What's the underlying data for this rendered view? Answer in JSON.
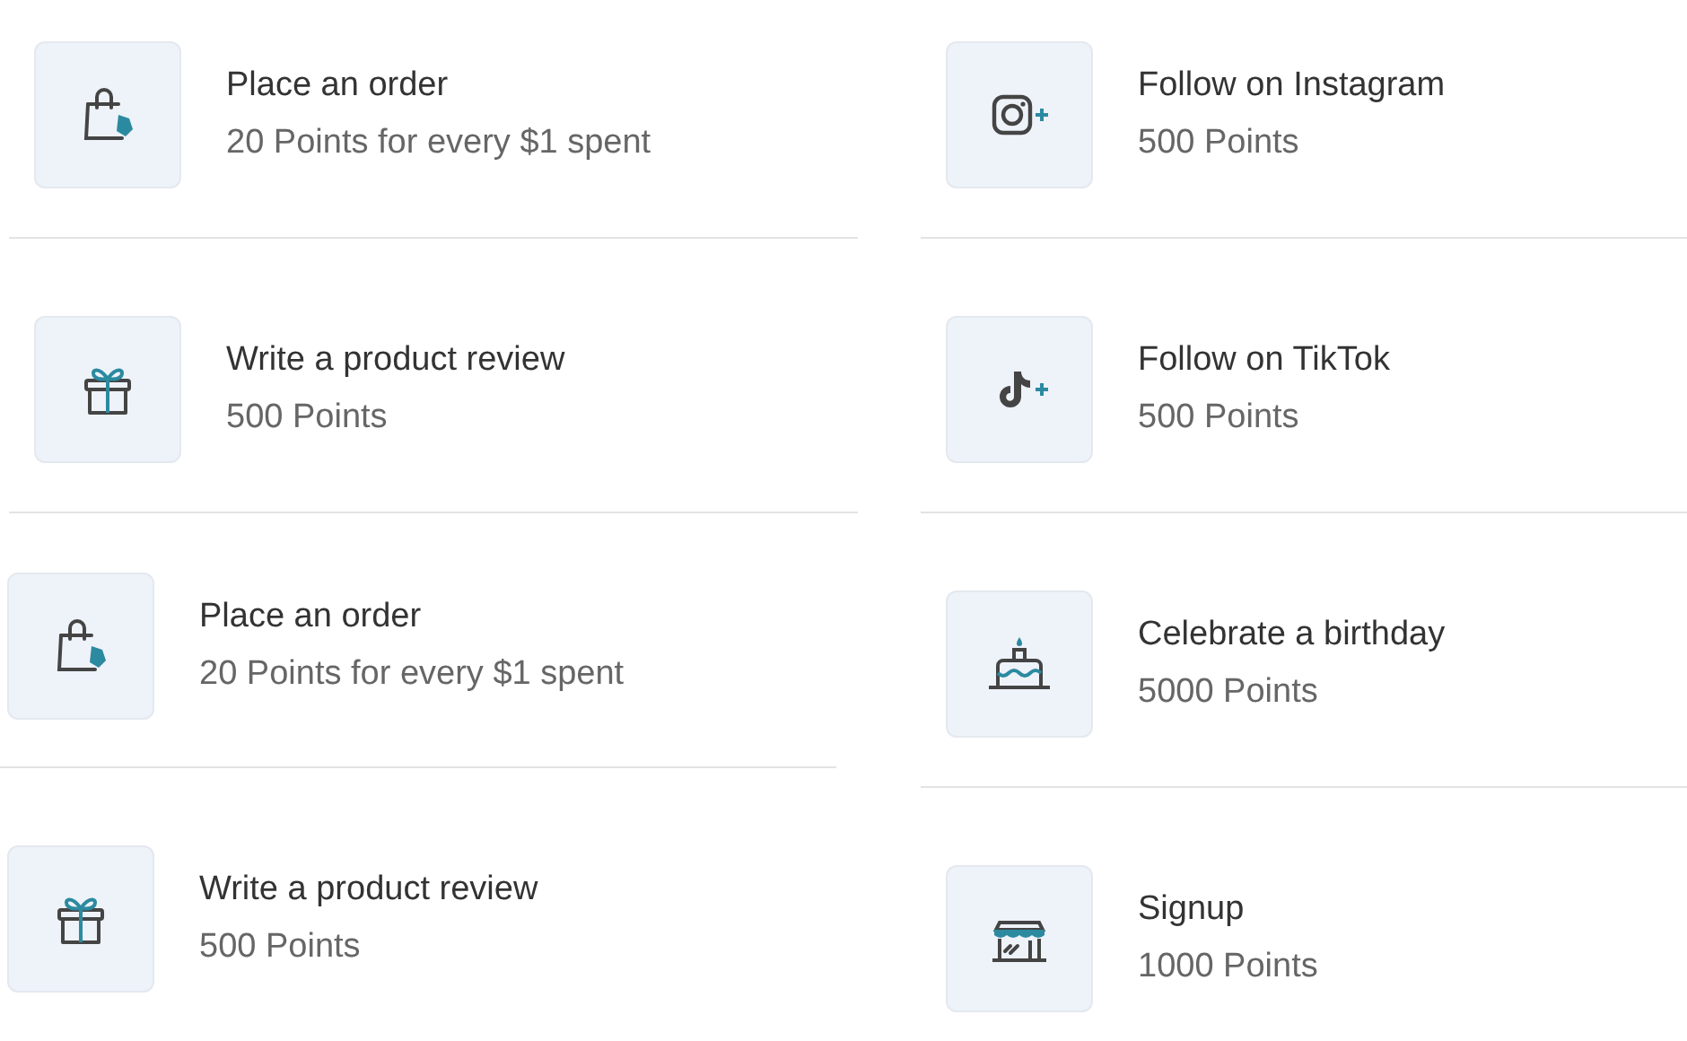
{
  "columns": [
    {
      "items": [
        {
          "kind": "bag",
          "title": "Place an order",
          "points": "20 Points for every $1 spent"
        },
        {
          "kind": "gift",
          "title": "Write a product review",
          "points": "500 Points"
        },
        {
          "kind": "bag",
          "title": "Place an order",
          "points": "20 Points for every $1 spent"
        },
        {
          "kind": "gift",
          "title": "Write a product review",
          "points": "500 Points"
        }
      ]
    },
    {
      "items": [
        {
          "kind": "instagram",
          "title": "Follow on Instagram",
          "points": "500 Points"
        },
        {
          "kind": "tiktok",
          "title": "Follow on TikTok",
          "points": "500 Points"
        },
        {
          "kind": "cake",
          "title": "Celebrate a birthday",
          "points": "5000 Points"
        },
        {
          "kind": "store",
          "title": "Signup",
          "points": "1000 Points"
        }
      ]
    }
  ]
}
